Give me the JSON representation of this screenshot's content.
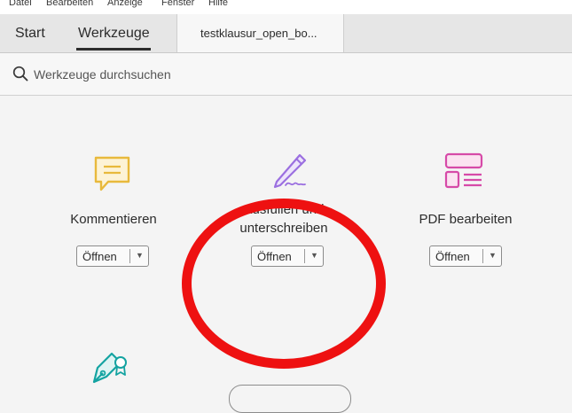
{
  "menu": {
    "items": [
      "Datei",
      "Bearbeiten",
      "Anzeige",
      "Fenster",
      "Hilfe"
    ]
  },
  "tabs": {
    "start": "Start",
    "tools": "Werkzeuge",
    "document": "testklausur_open_bo..."
  },
  "search": {
    "placeholder": "Werkzeuge durchsuchen"
  },
  "tools": [
    {
      "label": "Kommentieren",
      "button": "Öffnen",
      "icon": "comment-icon",
      "color": "#e8b93c"
    },
    {
      "label_line1": "Ausfüllen und",
      "label_line2": "unterschreiben",
      "button": "Öffnen",
      "icon": "fill-sign-pen-icon",
      "color": "#9b6fe0"
    },
    {
      "label": "PDF bearbeiten",
      "button": "Öffnen",
      "icon": "edit-pdf-icon",
      "color": "#d64aa8"
    },
    {
      "icon": "certificate-pen-icon",
      "color": "#14a3a1"
    }
  ],
  "highlight_color": "#ee1111"
}
